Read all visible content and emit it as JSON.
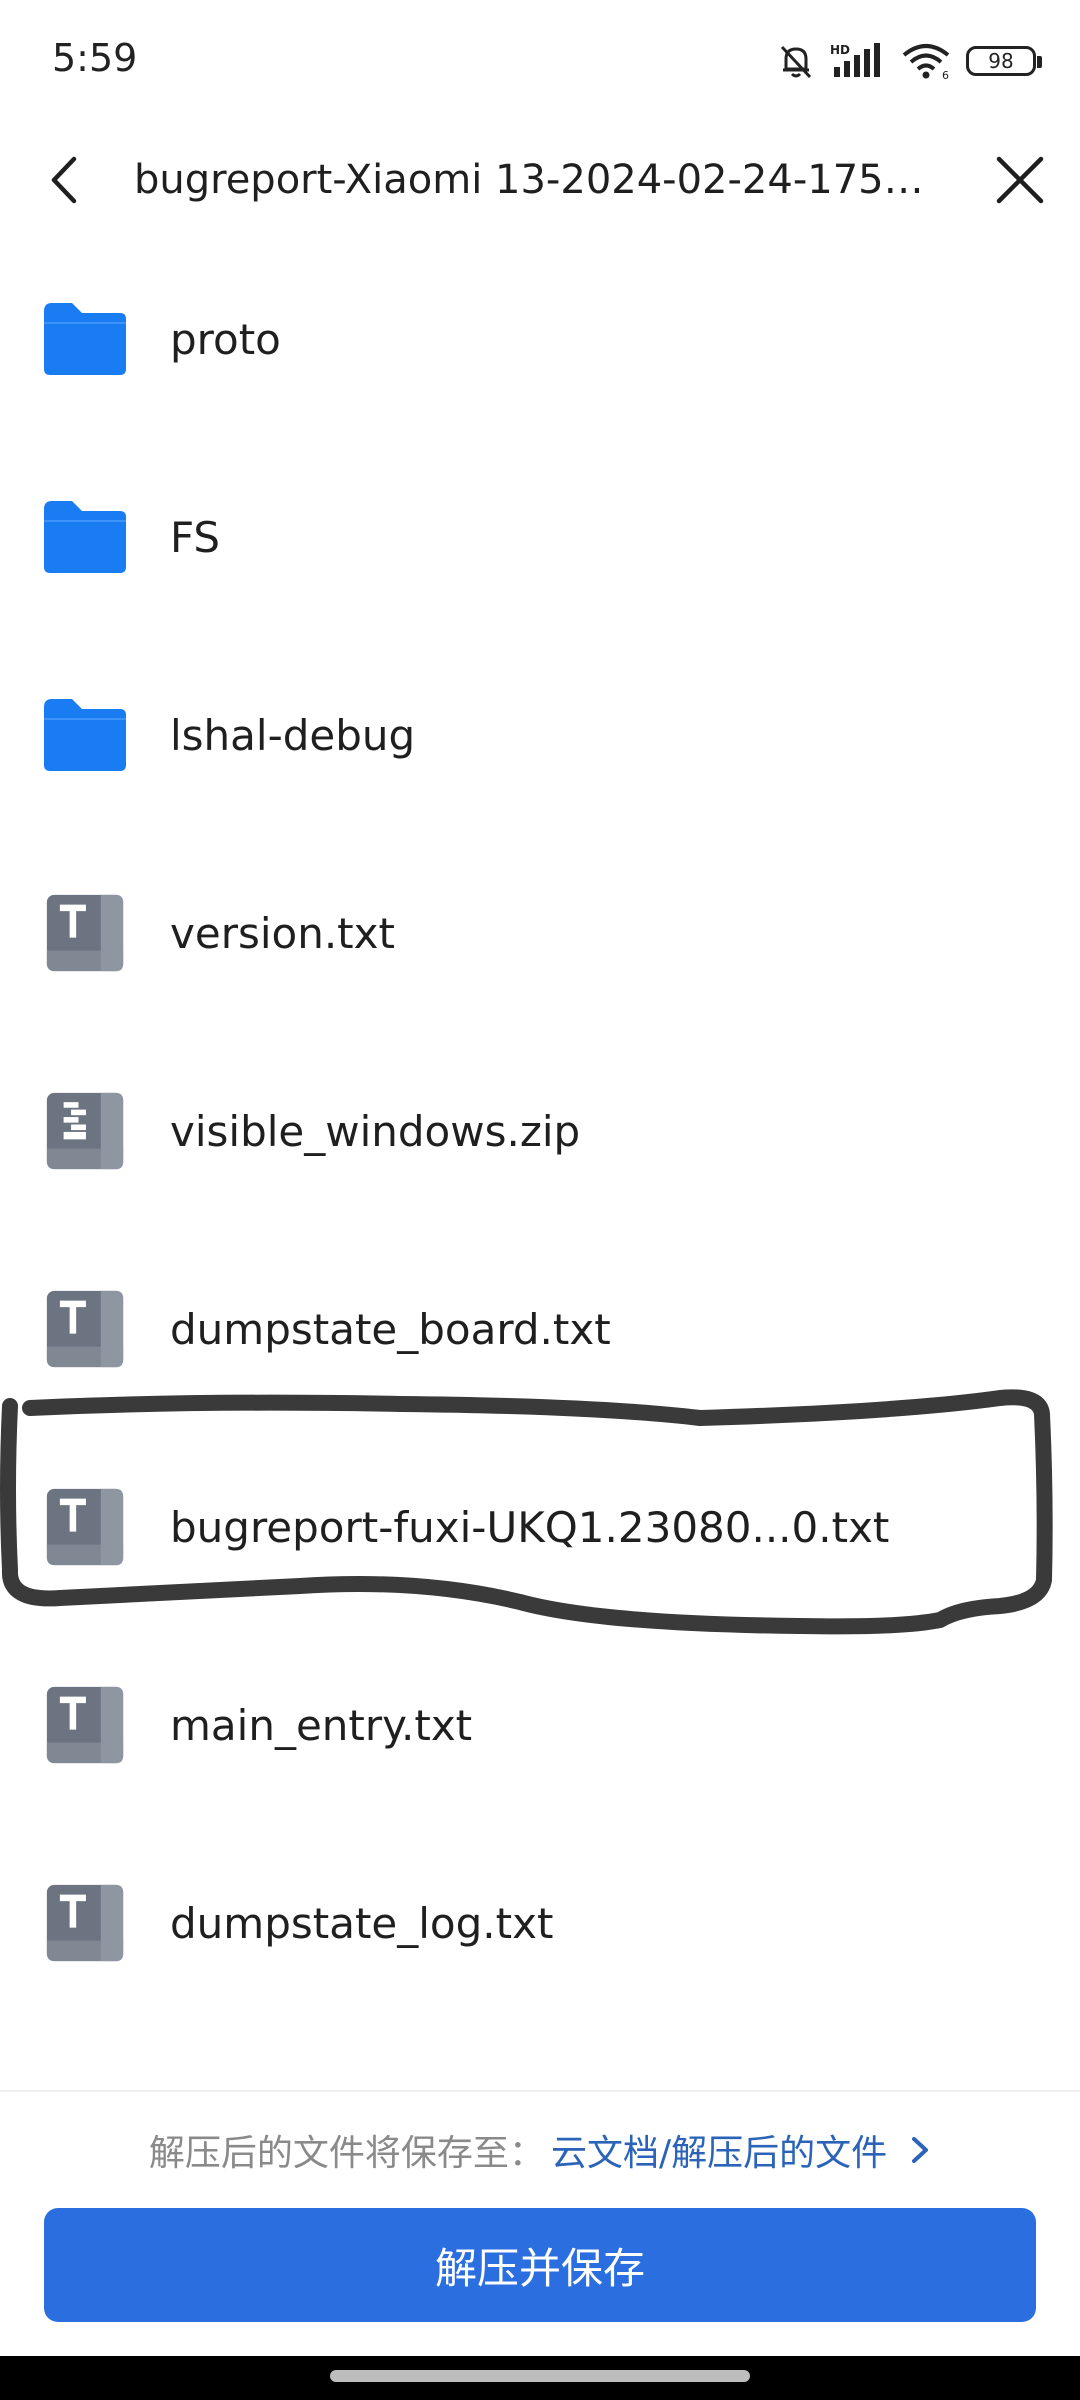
{
  "status_bar": {
    "time": "5:59",
    "battery": "98",
    "icons": [
      "bell-muted-icon",
      "hd-signal-icon",
      "wifi-icon",
      "battery-icon"
    ]
  },
  "header": {
    "title": "bugreport-Xiaomi 13-2024-02-24-175…",
    "back_icon": "back-arrow-icon",
    "close_icon": "close-icon"
  },
  "files": [
    {
      "name": "proto",
      "icon": "folder-icon"
    },
    {
      "name": "FS",
      "icon": "folder-icon"
    },
    {
      "name": "lshal-debug",
      "icon": "folder-icon"
    },
    {
      "name": "version.txt",
      "icon": "text-file-icon"
    },
    {
      "name": "visible_windows.zip",
      "icon": "zip-file-icon"
    },
    {
      "name": "dumpstate_board.txt",
      "icon": "text-file-icon"
    },
    {
      "name": "bugreport-fuxi-UKQ1.23080...0.txt",
      "icon": "text-file-icon"
    },
    {
      "name": "main_entry.txt",
      "icon": "text-file-icon"
    },
    {
      "name": "dumpstate_log.txt",
      "icon": "text-file-icon"
    }
  ],
  "footer": {
    "save_label": "解压后的文件将保存至：",
    "save_path": "云文档/解压后的文件",
    "button_label": "解压并保存"
  },
  "colors": {
    "folder": "#1a7cf2",
    "file_icon": "#6b7480",
    "accent": "#2a6ee0",
    "link": "#2a63b8",
    "annotation": "#3a3a3a"
  }
}
